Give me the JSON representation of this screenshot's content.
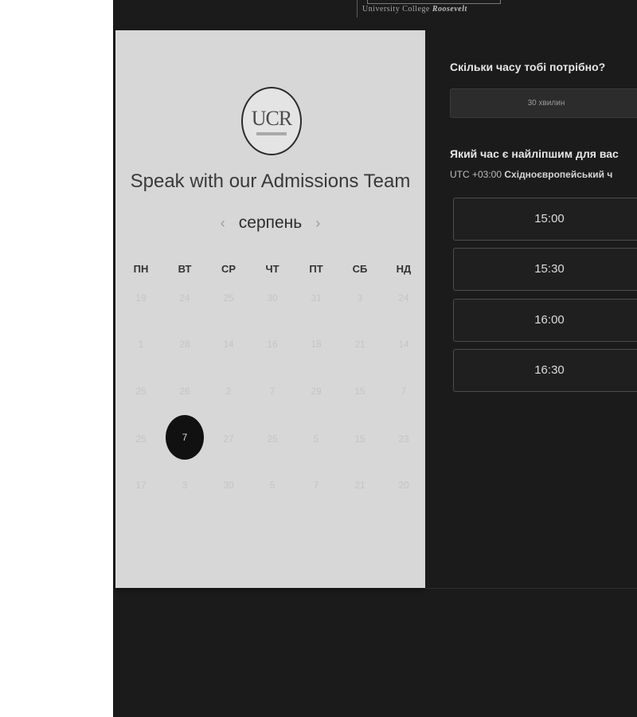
{
  "brand": {
    "name_prefix": "University College",
    "name_script": "Roosevelt"
  },
  "calendar": {
    "logo_text": "UCR",
    "title": "Speak with our Admissions Team",
    "month": "серпень",
    "prev_label": "‹",
    "next_label": "›",
    "weekdays": [
      "ПН",
      "ВТ",
      "СР",
      "ЧТ",
      "ПТ",
      "СБ",
      "НД"
    ],
    "weeks": [
      [
        "19",
        "24",
        "25",
        "30",
        "31",
        "3",
        "24"
      ],
      [
        "1",
        "28",
        "14",
        "16",
        "18",
        "21",
        "14"
      ],
      [
        "25",
        "26",
        "2",
        "7",
        "29",
        "15",
        "7"
      ],
      [
        "25",
        "7",
        "27",
        "25",
        "5",
        "15",
        "23"
      ],
      [
        "17",
        "3",
        "30",
        "5",
        "7",
        "21",
        "20"
      ]
    ],
    "selected_day": "7"
  },
  "booking": {
    "duration_question": "Скільки часу тобі потрібно?",
    "duration_value": "30 хвилин",
    "time_question": "Який час є найліпшим для вас",
    "timezone_offset": "UTC +03:00",
    "timezone_name": "Східноєвропейський ч",
    "slots": [
      "15:00",
      "15:30",
      "16:00",
      "16:30"
    ]
  },
  "colors": {
    "background": "#1b1b1b",
    "calendar_panel": "#d7d7d7",
    "selected_day": "#111111"
  }
}
